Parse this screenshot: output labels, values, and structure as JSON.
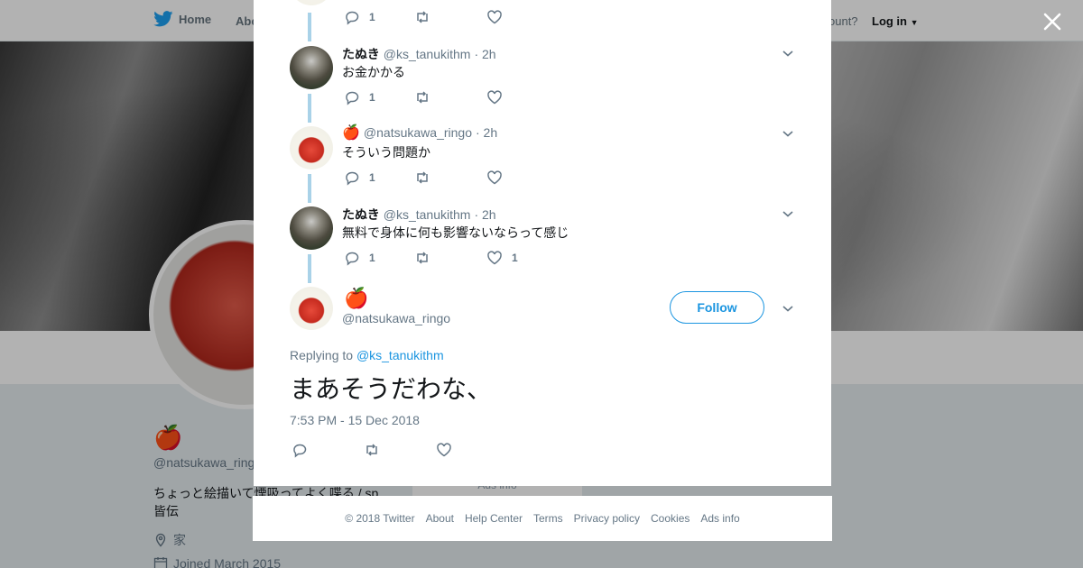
{
  "nav": {
    "home_label": "Home",
    "about_label": "Abo",
    "account_prompt": "ccount?",
    "login_label": "Log in"
  },
  "profile": {
    "name_emoji": "🍎",
    "handle": "@natsukawa_ringo",
    "bio": "ちょっと絵描いて煙吸ってよく喋る / sp 皆伝",
    "location": "家",
    "joined": "Joined March 2015",
    "ads_info": "Ads info"
  },
  "thread": [
    {
      "name": "",
      "username": "",
      "time": "",
      "text": "",
      "reply_count": "1",
      "retweet_count": "",
      "like_count": ""
    },
    {
      "name": "たぬき",
      "username": "@ks_tanukithm",
      "time": "· 2h",
      "text": "お金かかる",
      "reply_count": "1",
      "retweet_count": "",
      "like_count": ""
    },
    {
      "name": "🍎",
      "username": "@natsukawa_ringo",
      "time": "· 2h",
      "text": "そういう問題か",
      "reply_count": "1",
      "retweet_count": "",
      "like_count": ""
    },
    {
      "name": "たぬき",
      "username": "@ks_tanukithm",
      "time": "· 2h",
      "text": "無料で身体に何も影響ないならって感じ",
      "reply_count": "1",
      "retweet_count": "",
      "like_count": "1"
    }
  ],
  "main_tweet": {
    "name_emoji": "🍎",
    "username": "@natsukawa_ringo",
    "follow_label": "Follow",
    "replying_prefix": "Replying to",
    "replying_to": "@ks_tanukithm",
    "text": "まあそうだわな、",
    "timestamp": "7:53 PM - 15 Dec 2018"
  },
  "footer": {
    "links": [
      "© 2018 Twitter",
      "About",
      "Help Center",
      "Terms",
      "Privacy policy",
      "Cookies",
      "Ads info"
    ]
  },
  "icons": {
    "brand": "twitter-bird-icon",
    "close": "close-icon",
    "reply": "reply-icon",
    "retweet": "retweet-icon",
    "like": "heart-icon",
    "more": "chevron-down-icon",
    "location": "location-pin-icon",
    "calendar": "calendar-icon"
  },
  "colors": {
    "accent": "#1b95e0",
    "thread_line": "#a9d2e8",
    "secondary_text": "#657786"
  }
}
